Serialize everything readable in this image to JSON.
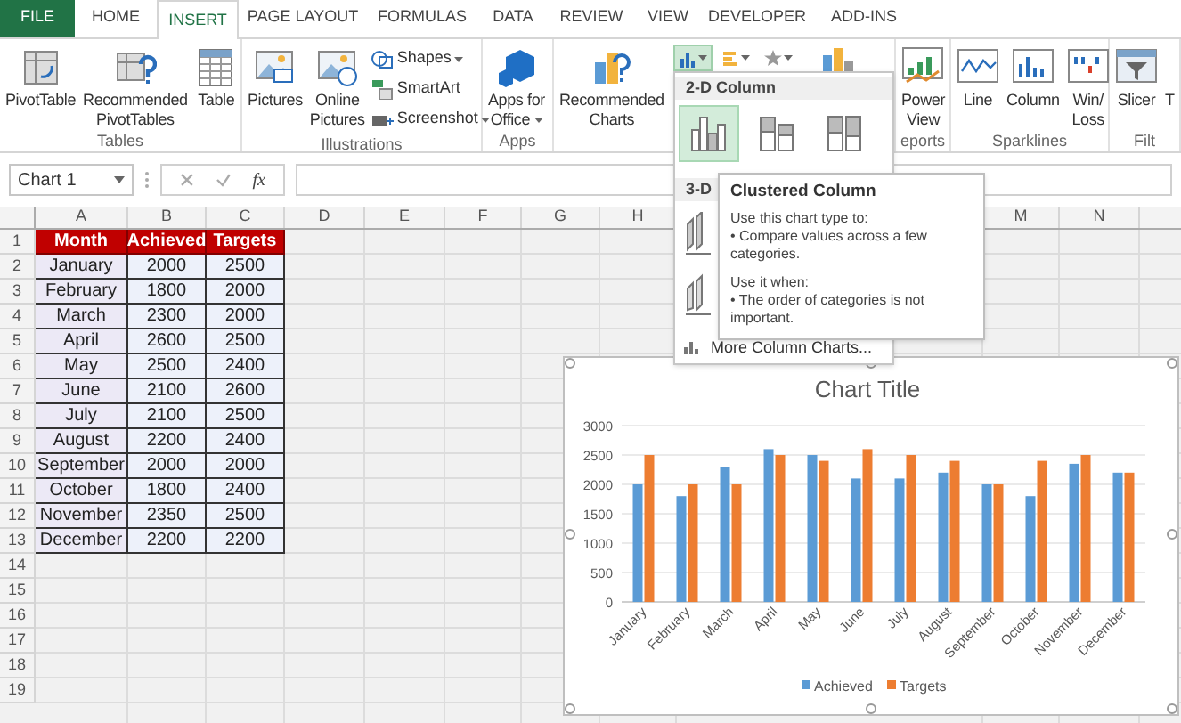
{
  "tabs": [
    {
      "label": "FILE",
      "kind": "file",
      "selected": false
    },
    {
      "label": "HOME",
      "kind": "tab",
      "selected": false
    },
    {
      "label": "INSERT",
      "kind": "tab",
      "selected": true
    },
    {
      "label": "PAGE LAYOUT",
      "kind": "tab",
      "selected": false
    },
    {
      "label": "FORMULAS",
      "kind": "tab",
      "selected": false
    },
    {
      "label": "DATA",
      "kind": "tab",
      "selected": false
    },
    {
      "label": "REVIEW",
      "kind": "tab",
      "selected": false
    },
    {
      "label": "VIEW",
      "kind": "tab",
      "selected": false
    },
    {
      "label": "DEVELOPER",
      "kind": "tab",
      "selected": false
    },
    {
      "label": "ADD-INS",
      "kind": "tab",
      "selected": false
    }
  ],
  "ribbon": [
    {
      "label": "Tables",
      "items": [
        {
          "kind": "large",
          "lines": [
            "PivotTable"
          ]
        },
        {
          "kind": "large",
          "lines": [
            "Recommended",
            "PivotTables"
          ]
        },
        {
          "kind": "large",
          "lines": [
            "Table"
          ]
        }
      ]
    },
    {
      "label": "Illustrations",
      "items": [
        {
          "kind": "large",
          "lines": [
            "Pictures"
          ]
        },
        {
          "kind": "large",
          "lines": [
            "Online",
            "Pictures"
          ]
        },
        {
          "kind": "stack",
          "entries": [
            {
              "label": "Shapes",
              "has_menu": true
            },
            {
              "label": "SmartArt",
              "has_menu": false
            },
            {
              "label": "Screenshot",
              "has_menu": true
            }
          ]
        }
      ]
    },
    {
      "label": "Apps",
      "items": [
        {
          "kind": "large",
          "lines": [
            "Apps for",
            "Office"
          ],
          "has_menu": true
        }
      ]
    },
    {
      "items": [
        {
          "kind": "large",
          "lines": [
            "Recommended",
            "Charts"
          ]
        },
        {
          "kind": "chart_types",
          "buttons": [
            {
              "selected": true
            },
            {
              "selected": false
            },
            {
              "selected": false
            }
          ]
        },
        {
          "kind": "icon_only"
        }
      ]
    },
    {
      "label": "eports",
      "items": [
        {
          "kind": "large",
          "lines": [
            "Power",
            "View"
          ]
        }
      ]
    },
    {
      "label": "Sparklines",
      "items": [
        {
          "kind": "large",
          "lines": [
            "Line"
          ]
        },
        {
          "kind": "large",
          "lines": [
            "Column"
          ]
        },
        {
          "kind": "large",
          "lines": [
            "Win/",
            "Loss"
          ]
        }
      ]
    },
    {
      "label": "Filt",
      "items": [
        {
          "kind": "large",
          "lines": [
            "Slicer"
          ]
        },
        {
          "kind": "large",
          "lines": [
            "T"
          ]
        }
      ]
    }
  ],
  "formula_bar": {
    "name_box": "Chart 1",
    "function_label": "fx"
  },
  "column_headers": [
    "A",
    "B",
    "C",
    "D",
    "E",
    "F",
    "G",
    "H",
    "M",
    "N"
  ],
  "row_numbers": [
    "1",
    "2",
    "3",
    "4",
    "5",
    "6",
    "7",
    "8",
    "9",
    "10",
    "11",
    "12",
    "13",
    "14",
    "15",
    "16",
    "17",
    "18",
    "19"
  ],
  "table": {
    "header": [
      "Month",
      "Achieved",
      "Targets"
    ],
    "rows": [
      [
        "January",
        "2000",
        "2500"
      ],
      [
        "February",
        "1800",
        "2000"
      ],
      [
        "March",
        "2300",
        "2000"
      ],
      [
        "April",
        "2600",
        "2500"
      ],
      [
        "May",
        "2500",
        "2400"
      ],
      [
        "June",
        "2100",
        "2600"
      ],
      [
        "July",
        "2100",
        "2500"
      ],
      [
        "August",
        "2200",
        "2400"
      ],
      [
        "September",
        "2000",
        "2000"
      ],
      [
        "October",
        "1800",
        "2400"
      ],
      [
        "November",
        "2350",
        "2500"
      ],
      [
        "December",
        "2200",
        "2200"
      ]
    ]
  },
  "chart_menu": {
    "sections": [
      {
        "title": "2-D Column",
        "options": [
          {
            "selected": true
          },
          {
            "selected": false
          },
          {
            "selected": false
          }
        ]
      },
      {
        "title": "3-D",
        "options": [
          {
            "selected": false
          },
          {
            "selected": false
          }
        ]
      }
    ],
    "more_link": "More Column Charts..."
  },
  "tooltip": {
    "title": "Clustered Column",
    "paragraphs": [
      {
        "heading": "Use this chart type to:",
        "bullet": "• Compare values across a few categories."
      },
      {
        "heading": "Use it when:",
        "bullet": "• The order of categories is not important."
      }
    ]
  },
  "chart": {
    "chart_data": {
      "type": "bar",
      "title": "Chart Title",
      "categories": [
        "January",
        "February",
        "March",
        "April",
        "May",
        "June",
        "July",
        "August",
        "September",
        "October",
        "November",
        "December"
      ],
      "series": [
        {
          "name": "Achieved",
          "color": "#5b9bd5",
          "values": [
            2000,
            1800,
            2300,
            2600,
            2500,
            2100,
            2100,
            2200,
            2000,
            1800,
            2350,
            2200
          ]
        },
        {
          "name": "Targets",
          "color": "#ed7d31",
          "values": [
            2500,
            2000,
            2000,
            2500,
            2400,
            2600,
            2500,
            2400,
            2000,
            2400,
            2500,
            2200
          ]
        }
      ],
      "ylim": [
        0,
        3000
      ],
      "yticks": [
        {
          "value": 0,
          "label": "0"
        },
        {
          "value": 500,
          "label": "500"
        },
        {
          "value": 1000,
          "label": "1000"
        },
        {
          "value": 1500,
          "label": "1500"
        },
        {
          "value": 2000,
          "label": "2000"
        },
        {
          "value": 2500,
          "label": "2500"
        },
        {
          "value": 3000,
          "label": "3000"
        }
      ],
      "grid": true,
      "legend": true
    }
  }
}
